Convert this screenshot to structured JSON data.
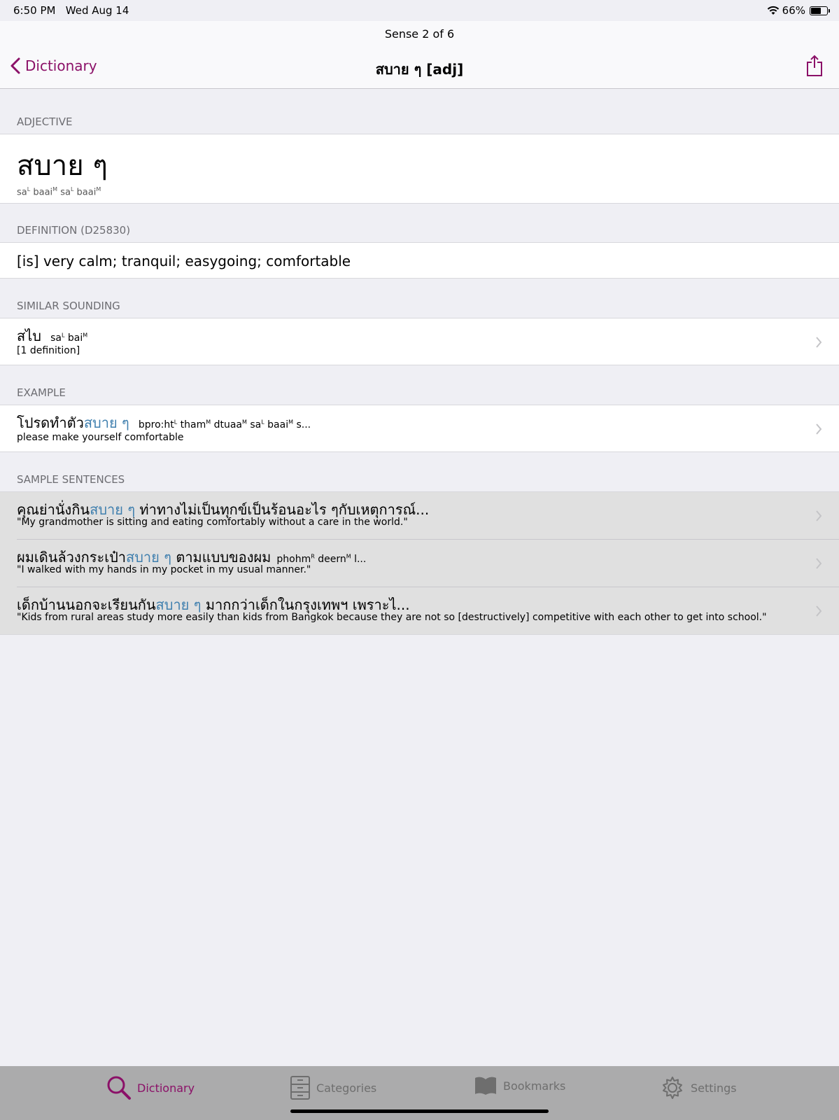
{
  "status_bar": {
    "time": "6:50 PM",
    "date": "Wed Aug 14",
    "battery": "66%",
    "battery_level": 0.66
  },
  "nav": {
    "subtitle": "Sense 2 of 6",
    "back_label": "Dictionary",
    "title": "สบาย ๆ [adj]"
  },
  "sections": {
    "part_of_speech": "ADJECTIVE",
    "definition_header": "DEFINITION (D25830)",
    "similar_header": "SIMILAR SOUNDING",
    "example_header": "EXAMPLE",
    "samples_header": "SAMPLE SENTENCES"
  },
  "entry": {
    "headword": "สบาย ๆ",
    "pron": [
      {
        "syl": "sa",
        "tone": "L"
      },
      {
        "syl": "baai",
        "tone": "M"
      },
      {
        "syl": "sa",
        "tone": "L"
      },
      {
        "syl": "baai",
        "tone": "M"
      }
    ],
    "definition": "[is] very calm; tranquil; easygoing; comfortable"
  },
  "similar": {
    "thai": "สไบ",
    "pron": [
      {
        "syl": "sa",
        "tone": "L"
      },
      {
        "syl": "bai",
        "tone": "M"
      }
    ],
    "detail": "[1 definition]"
  },
  "example": {
    "thai_before": "โปรดทำตัว",
    "thai_highlight": "สบาย ๆ",
    "pron": [
      {
        "syl": "bpro:ht",
        "tone": "L"
      },
      {
        "syl": "tham",
        "tone": "M"
      },
      {
        "syl": "dtuaa",
        "tone": "M"
      },
      {
        "syl": "sa",
        "tone": "L"
      },
      {
        "syl": "baai",
        "tone": "M"
      }
    ],
    "pron_tail": "s...",
    "english": "please make yourself comfortable"
  },
  "samples": [
    {
      "before": "คุณย่านั่งกิน",
      "highlight": "สบาย ๆ",
      "after": " ท่าทางไม่เป็นทุกข์เป็นร้อนอะไร ๆกับเหตุการณ์...",
      "pron": [],
      "pron_tail": "",
      "english": "\"My grandmother is sitting and eating comfortably without a care in the world.\""
    },
    {
      "before": "ผมเดินล้วงกระเป๋า",
      "highlight": "สบาย ๆ",
      "after": " ตามแบบของผม",
      "pron": [
        {
          "syl": "phohm",
          "tone": "R"
        },
        {
          "syl": "deern",
          "tone": "M"
        }
      ],
      "pron_tail": "l...",
      "english": "\"I walked with my hands in my pocket in my usual manner.\""
    },
    {
      "before": "เด็กบ้านนอกจะเรียนกัน",
      "highlight": "สบาย ๆ",
      "after": " มากกว่าเด็กในกรุงเทพฯ เพราะไ...",
      "pron": [],
      "pron_tail": "",
      "english": "\"Kids from rural areas study more easily than kids from Bangkok because they are not so [destructively] competitive with each other to get into school.\""
    }
  ],
  "tabs": [
    {
      "label": "Dictionary",
      "icon": "search-icon",
      "active": true
    },
    {
      "label": "Categories",
      "icon": "cabinet-icon",
      "active": false
    },
    {
      "label": "Bookmarks",
      "icon": "book-icon",
      "active": false
    },
    {
      "label": "Settings",
      "icon": "gear-icon",
      "active": false
    }
  ],
  "colors": {
    "accent": "#8b1168",
    "highlight": "#3f7fae",
    "background": "#efeff4"
  }
}
